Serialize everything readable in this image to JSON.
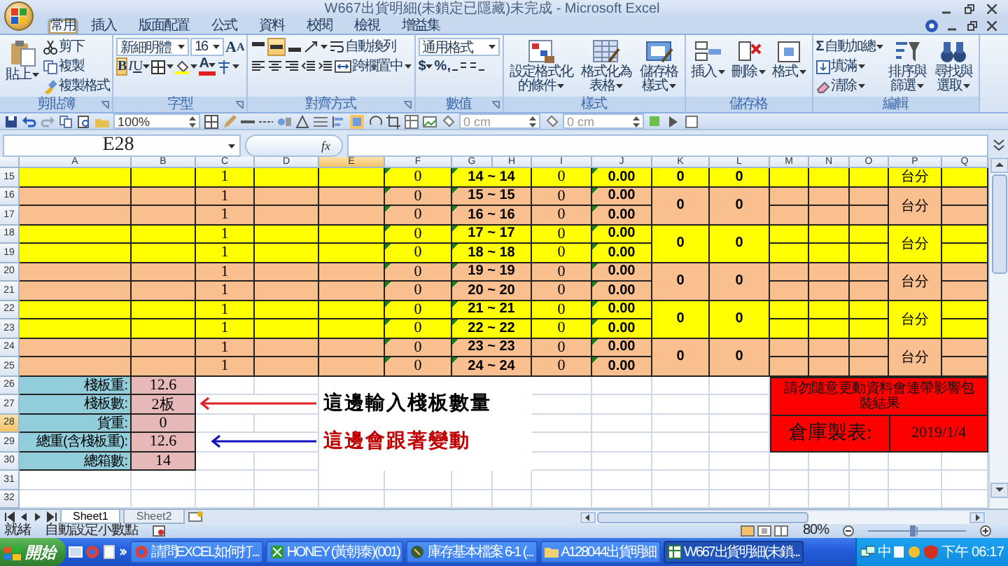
{
  "window": {
    "title": "W667出貨明細(未鎖定已隱藏)未完成 - Microsoft Excel"
  },
  "ribbon": {
    "tabs": [
      {
        "label": "常用",
        "selected": true
      },
      {
        "label": "插入",
        "selected": false
      },
      {
        "label": "版面配置",
        "selected": false
      },
      {
        "label": "公式",
        "selected": false
      },
      {
        "label": "資料",
        "selected": false
      },
      {
        "label": "校閱",
        "selected": false
      },
      {
        "label": "檢視",
        "selected": false
      },
      {
        "label": "增益集",
        "selected": false
      }
    ],
    "groups": [
      {
        "kind": "clipboard",
        "label": "剪貼簿",
        "paste": "貼上",
        "actions": [
          "剪下",
          "複製",
          "複製格式"
        ]
      },
      {
        "kind": "font",
        "label": "字型",
        "font": "新細明體",
        "size": "16",
        "grow": "A",
        "shrink": "A",
        "styles": [
          {
            "label": "B",
            "on": true
          },
          {
            "label": "I",
            "on": false
          },
          {
            "label": "U",
            "on": false
          }
        ],
        "color_letter": "A"
      },
      {
        "kind": "alignment",
        "label": "對齊方式",
        "vertical_align": [
          {
            "selected": false
          },
          {
            "selected": true
          },
          {
            "selected": false
          }
        ],
        "wrap": "自動換列",
        "merge": "跨欄置中"
      },
      {
        "kind": "number",
        "label": "數值",
        "format": "通用格式",
        "symbols": [
          "$",
          "%",
          ","
        ]
      },
      {
        "kind": "styles",
        "label": "樣式",
        "buttons": [
          "設定格式化的條件",
          "格式化為表格",
          "儲存格樣式"
        ]
      },
      {
        "kind": "cells",
        "label": "儲存格",
        "buttons": [
          "插入",
          "刪除",
          "格式"
        ]
      },
      {
        "kind": "editing",
        "label": "編輯",
        "sum_symbol": "Σ",
        "actions": [
          "自動加總",
          "填滿",
          "清除"
        ],
        "buttons": [
          "排序與篩選",
          "尋找與選取"
        ]
      }
    ]
  },
  "quick_toolbar": {
    "zoom": "100%",
    "measures": [
      "0 cm",
      "0 cm"
    ]
  },
  "formula_bar": {
    "name_box": "E28",
    "function_label": "fx"
  },
  "sheet": {
    "columns": [
      {
        "label": "A",
        "selected": false
      },
      {
        "label": "B",
        "selected": false
      },
      {
        "label": "C",
        "selected": false
      },
      {
        "label": "D",
        "selected": false
      },
      {
        "label": "E",
        "selected": true
      },
      {
        "label": "F",
        "selected": false
      },
      {
        "label": "G",
        "selected": false
      },
      {
        "label": "H",
        "selected": false
      },
      {
        "label": "I",
        "selected": false
      },
      {
        "label": "J",
        "selected": false
      },
      {
        "label": "K",
        "selected": false
      },
      {
        "label": "L",
        "selected": false
      },
      {
        "label": "M",
        "selected": false
      },
      {
        "label": "N",
        "selected": false
      },
      {
        "label": "O",
        "selected": false
      },
      {
        "label": "P",
        "selected": false
      },
      {
        "label": "Q",
        "selected": false
      }
    ],
    "blocks": [
      {
        "color": "#ffff00",
        "k": "0",
        "l": "0",
        "p": "台分",
        "rows": [
          {
            "number": "15",
            "selected": false,
            "c": "1",
            "f": "0",
            "range": "14 ~ 14",
            "i": "0",
            "j": "0.00"
          }
        ]
      },
      {
        "color": "#fabf8f",
        "k": "0",
        "l": "0",
        "p": "台分",
        "rows": [
          {
            "number": "16",
            "selected": false,
            "c": "1",
            "f": "0",
            "range": "15 ~ 15",
            "i": "0",
            "j": "0.00"
          },
          {
            "number": "17",
            "selected": false,
            "c": "1",
            "f": "0",
            "range": "16 ~ 16",
            "i": "0",
            "j": "0.00"
          }
        ]
      },
      {
        "color": "#ffff00",
        "k": "0",
        "l": "0",
        "p": "台分",
        "rows": [
          {
            "number": "18",
            "selected": false,
            "c": "1",
            "f": "0",
            "range": "17 ~ 17",
            "i": "0",
            "j": "0.00"
          },
          {
            "number": "19",
            "selected": false,
            "c": "1",
            "f": "0",
            "range": "18 ~ 18",
            "i": "0",
            "j": "0.00"
          }
        ]
      },
      {
        "color": "#fabf8f",
        "k": "0",
        "l": "0",
        "p": "台分",
        "rows": [
          {
            "number": "20",
            "selected": false,
            "c": "1",
            "f": "0",
            "range": "19 ~ 19",
            "i": "0",
            "j": "0.00"
          },
          {
            "number": "21",
            "selected": false,
            "c": "1",
            "f": "0",
            "range": "20 ~ 20",
            "i": "0",
            "j": "0.00"
          }
        ]
      },
      {
        "color": "#ffff00",
        "k": "0",
        "l": "0",
        "p": "台分",
        "rows": [
          {
            "number": "22",
            "selected": false,
            "c": "1",
            "f": "0",
            "range": "21 ~ 21",
            "i": "0",
            "j": "0.00"
          },
          {
            "number": "23",
            "selected": false,
            "c": "1",
            "f": "0",
            "range": "22 ~ 22",
            "i": "0",
            "j": "0.00"
          }
        ]
      },
      {
        "color": "#fabf8f",
        "k": "0",
        "l": "0",
        "p": "台分",
        "rows": [
          {
            "number": "24",
            "selected": false,
            "c": "1",
            "f": "0",
            "range": "23 ~ 23",
            "i": "0",
            "j": "0.00"
          },
          {
            "number": "25",
            "selected": false,
            "c": "1",
            "f": "0",
            "range": "24 ~ 24",
            "i": "0",
            "j": "0.00"
          }
        ]
      }
    ],
    "summary": [
      {
        "number": "26",
        "selected": false,
        "label": "棧板重:",
        "value": "12.6"
      },
      {
        "number": "27",
        "selected": false,
        "label": "棧板數:",
        "value": "2板"
      },
      {
        "number": "28",
        "selected": true,
        "label": "貨重:",
        "value": "0"
      },
      {
        "number": "29",
        "selected": false,
        "label": "總重(含棧板重):",
        "value": "12.6"
      },
      {
        "number": "30",
        "selected": false,
        "label": "總箱數:",
        "value": "14"
      }
    ],
    "empty_rows": [
      {
        "number": "31",
        "selected": false
      },
      {
        "number": "32",
        "selected": false
      }
    ],
    "annotations": [
      {
        "text": "這邊輸入棧板數量",
        "color": "#000000"
      },
      {
        "text": "這邊會跟著變動",
        "color": "#c00000"
      }
    ],
    "arrows": [
      {
        "color": "#e02020"
      },
      {
        "color": "#1010c0"
      }
    ],
    "notice": {
      "warning": "請勿隨意更動資料會連帶影響包裝結果",
      "label": "倉庫製表:",
      "date": "2019/1/4"
    }
  },
  "sheet_tabs": [
    {
      "label": "Sheet1",
      "selected": true
    },
    {
      "label": "Sheet2",
      "selected": false
    }
  ],
  "status_bar": {
    "state": "就緒",
    "mode": "自動設定小數點",
    "zoom": "80%",
    "zoom_slider": {
      "level": 0.45
    }
  },
  "taskbar": {
    "start": "開始",
    "tasks": [
      {
        "label": "請問EXCEL如何打...",
        "selected": false
      },
      {
        "label": "HONEY (黃朝泰)(001)",
        "selected": false
      },
      {
        "label": "庫存基本檔案 6-1 (...",
        "selected": false
      },
      {
        "label": "A128044出貨明細",
        "selected": false
      },
      {
        "label": "W667出貨明細(未鎖...",
        "selected": true
      }
    ],
    "input_method": "中",
    "clock": "下午 06:17"
  }
}
